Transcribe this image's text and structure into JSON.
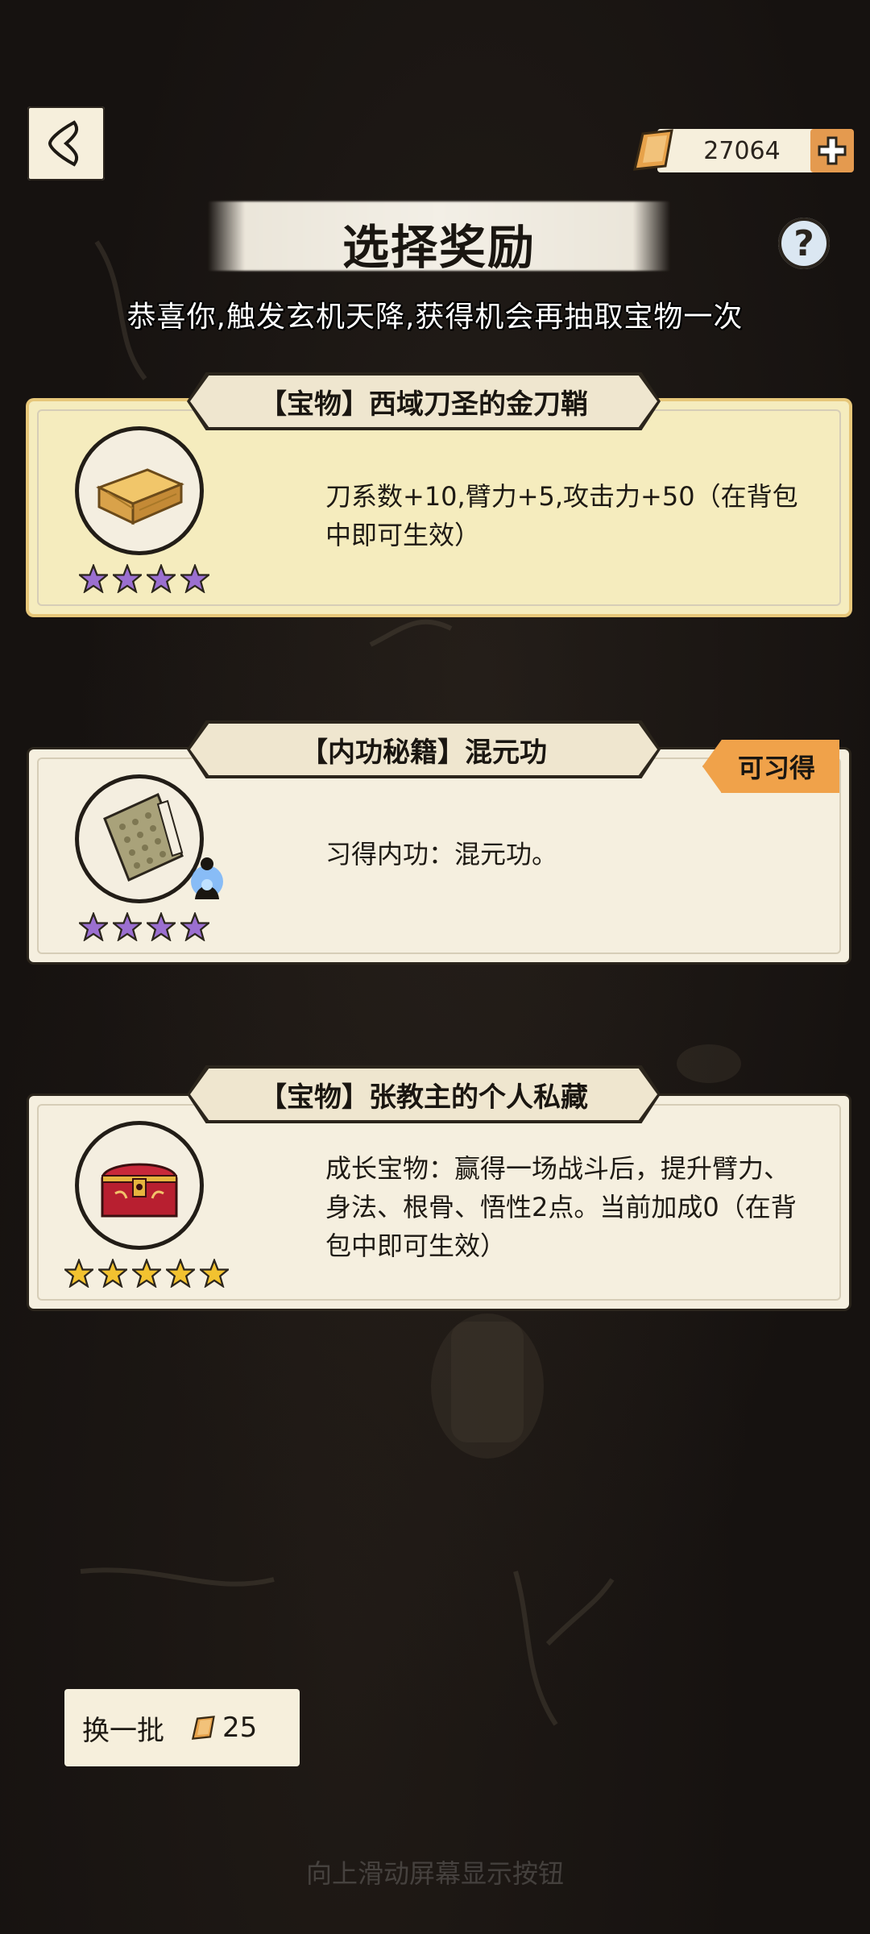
{
  "header": {
    "back_icon": "back-arrow-icon",
    "currency_icon": "gold-ingot-icon",
    "currency_amount": "27064",
    "add_icon": "plus-icon",
    "title": "选择奖励",
    "help_label": "?",
    "subtitle": "恭喜你,触发玄机天降,获得机会再抽取宝物一次"
  },
  "rewards": [
    {
      "title": "【宝物】西域刀圣的金刀鞘",
      "description": "刀系数+10,臂力+5,攻击力+50（在背包中即可生效）",
      "icon": "golden-scabbard-box-icon",
      "stars": 4,
      "star_color": "#9b6fd0",
      "highlighted": true
    },
    {
      "title": "【内功秘籍】混元功",
      "description": "习得内功：混元功。",
      "icon": "martial-manual-book-icon",
      "badge_icon": "meditating-figure-icon",
      "stars": 4,
      "star_color": "#9b6fd0",
      "tag": "可习得"
    },
    {
      "title": "【宝物】张教主的个人私藏",
      "description": "成长宝物：赢得一场战斗后，提升臂力、身法、根骨、悟性2点。当前加成0（在背包中即可生效）",
      "icon": "red-treasure-chest-icon",
      "stars": 5,
      "star_color": "#f2c230"
    }
  ],
  "footer": {
    "refresh_label": "换一批",
    "refresh_cost_icon": "gold-ingot-icon",
    "refresh_cost": "25",
    "hint": "向上滑动屏幕显示按钮"
  }
}
